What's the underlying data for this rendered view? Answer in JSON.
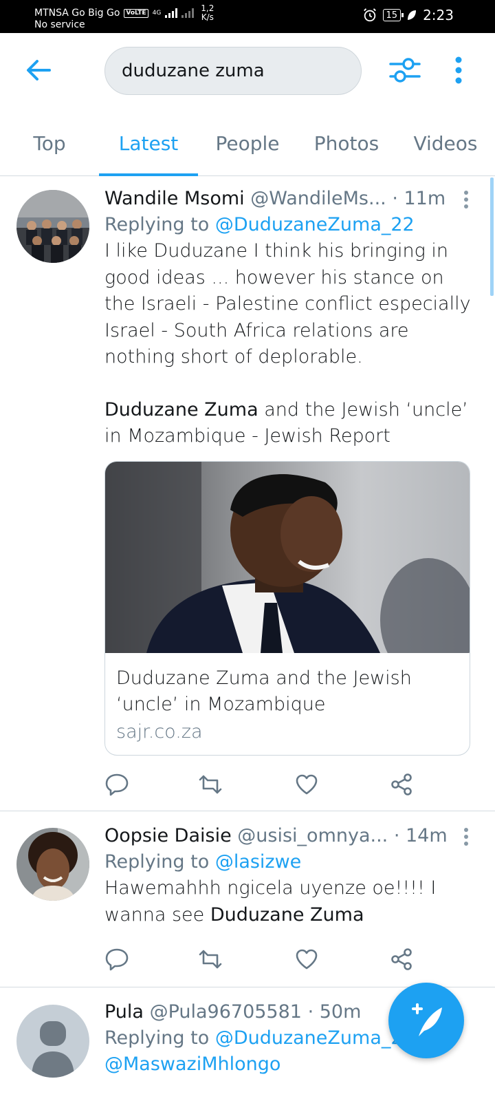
{
  "status_bar": {
    "carrier": "MTNSA Go Big Go",
    "volte": "VoLTE",
    "network": "4G",
    "no_service": "No service",
    "speed_value": "1,2",
    "speed_unit": "K/s",
    "battery": "15",
    "time": "2:23"
  },
  "search": {
    "query": "duduzane zuma"
  },
  "tabs": [
    "Top",
    "Latest",
    "People",
    "Photos",
    "Videos"
  ],
  "active_tab": "Latest",
  "tweets": [
    {
      "name": "Wandile Msomi",
      "handle": "@WandileMs...",
      "time": "· 11m",
      "replying_label": "Replying to",
      "replying_to": "@DuduzaneZuma_22",
      "text_1": "I like Duduzane I think his bringing in good ideas ... however his stance on the Israeli - Palestine conflict especially Israel - South Africa relations are nothing short of deplorable.",
      "text_2_highlight": "Duduzane Zuma",
      "text_2_rest": " and the Jewish ‘uncle’ in Mozambique - Jewish Report",
      "card": {
        "title": "Duduzane Zuma and the Jewish ‘uncle’ in Mozambique",
        "domain": "sajr.co.za"
      }
    },
    {
      "name": "Oopsie Daisie",
      "handle": "@usisi_omnya...",
      "time": "· 14m",
      "replying_label": "Replying to",
      "replying_to": "@lasizwe",
      "text_plain": "Hawemahhh ngicela uyenze oe!!!! I wanna see ",
      "text_highlight": "Duduzane Zuma"
    },
    {
      "name": "Pula",
      "handle": "@Pula96705581",
      "time": "· 50m",
      "replying_label": "Replying to",
      "replying_to": "@DuduzaneZuma_22",
      "replying_to_2": "@MaswaziMhlongo"
    }
  ],
  "colors": {
    "accent": "#1da1f2",
    "secondary_text": "#657786",
    "divider": "#d4dbe0"
  }
}
